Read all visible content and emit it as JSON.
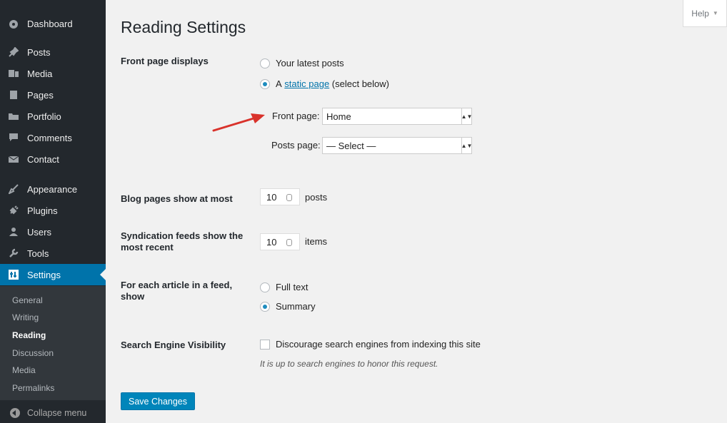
{
  "sidebar": {
    "items": [
      {
        "label": "Dashboard",
        "icon": "dashboard-icon"
      },
      {
        "label": "Posts",
        "icon": "pin-icon"
      },
      {
        "label": "Media",
        "icon": "media-icon"
      },
      {
        "label": "Pages",
        "icon": "pages-icon"
      },
      {
        "label": "Portfolio",
        "icon": "folder-icon"
      },
      {
        "label": "Comments",
        "icon": "comment-icon"
      },
      {
        "label": "Contact",
        "icon": "envelope-icon"
      },
      {
        "label": "Appearance",
        "icon": "brush-icon"
      },
      {
        "label": "Plugins",
        "icon": "plug-icon"
      },
      {
        "label": "Users",
        "icon": "user-icon"
      },
      {
        "label": "Tools",
        "icon": "wrench-icon"
      },
      {
        "label": "Settings",
        "icon": "settings-icon"
      }
    ],
    "submenu": [
      "General",
      "Writing",
      "Reading",
      "Discussion",
      "Media",
      "Permalinks"
    ],
    "collapse_label": "Collapse menu"
  },
  "help_label": "Help",
  "page_title": "Reading Settings",
  "front_page": {
    "label": "Front page displays",
    "option_latest": "Your latest posts",
    "option_static_prefix": "A",
    "option_static_link": "static page",
    "option_static_suffix": "(select below)",
    "front_label": "Front page:",
    "front_value": "Home",
    "posts_label": "Posts page:",
    "posts_value": "— Select —"
  },
  "blog_pages": {
    "label": "Blog pages show at most",
    "value": "10",
    "unit": "posts"
  },
  "syndication": {
    "label_line1": "Syndication feeds show the",
    "label_line2": "most recent",
    "value": "10",
    "unit": "items"
  },
  "feed_article": {
    "label_line1": "For each article in a feed,",
    "label_line2": "show",
    "option_full": "Full text",
    "option_summary": "Summary"
  },
  "search_engine": {
    "label": "Search Engine Visibility",
    "checkbox_label": "Discourage search engines from indexing this site",
    "description": "It is up to search engines to honor this request."
  },
  "save_button": "Save Changes",
  "colors": {
    "sidebar": "#23282d",
    "accent": "#0073aa",
    "button": "#0085ba",
    "annotation_arrow": "#d9322b"
  }
}
